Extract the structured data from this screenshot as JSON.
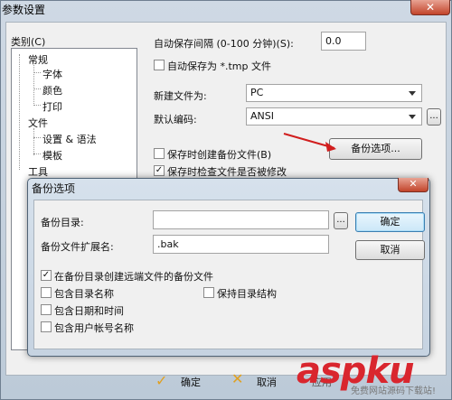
{
  "main_window": {
    "title": "参数设置",
    "close_glyph": "✕",
    "category_label": "类别(C)",
    "tree": [
      "常规",
      "字体",
      "颜色",
      "打印",
      "文件",
      "设置 & 语法",
      "模板",
      "工具"
    ],
    "autosave_interval_label": "自动保存间隔 (0-100 分钟)(S):",
    "autosave_interval_value": "0.0",
    "autosave_tmp_label": "自动保存为 *.tmp 文件",
    "new_file_label": "新建文件为:",
    "new_file_value": "PC",
    "encoding_label": "默认编码:",
    "encoding_value": "ANSI",
    "browse_label": "...",
    "backup_on_save_label": "保存时创建备份文件(B)",
    "backup_options_button": "备份选项...",
    "check_modified_label": "保存时检查文件是否被修改",
    "ok_label": "确定",
    "cancel_label": "取消",
    "apply_partial": "应用"
  },
  "dialog": {
    "title": "备份选项",
    "close_glyph": "✕",
    "backup_dir_label": "备份目录:",
    "backup_dir_value": "",
    "browse_label": "...",
    "ext_label": "备份文件扩展名:",
    "ext_value": ".bak",
    "ok_label": "确定",
    "cancel_label": "取消",
    "options": [
      {
        "label": "在备份目录创建远端文件的备份文件",
        "checked": true
      },
      {
        "label": "包含目录名称",
        "checked": false
      },
      {
        "label": "保持目录结构",
        "checked": false
      },
      {
        "label": "包含日期和时间",
        "checked": false
      },
      {
        "label": "包含用户帐号名称",
        "checked": false
      }
    ]
  },
  "watermark": {
    "logo": "aspku",
    "sub": "免费网站源码下载站!"
  },
  "colors": {
    "annotation_arrow": "#d11e1e",
    "watermark": "#d9262e"
  }
}
